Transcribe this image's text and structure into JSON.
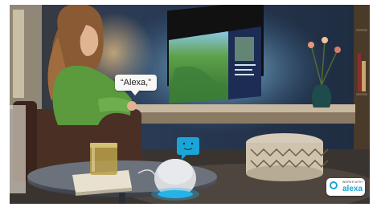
{
  "scene": {
    "speech_bubble_text": "“Alexa,”",
    "badge": {
      "small_text": "WORKS WITH",
      "brand_text": "alexa",
      "color": "#1aa5d6"
    },
    "colors": {
      "wall": "#2a3a52",
      "tv_glow": "#8fd0f0",
      "sweater": "#5c9a3e",
      "device_ring": "#27b3e6",
      "face_bubble": "#1aa5d6"
    }
  }
}
